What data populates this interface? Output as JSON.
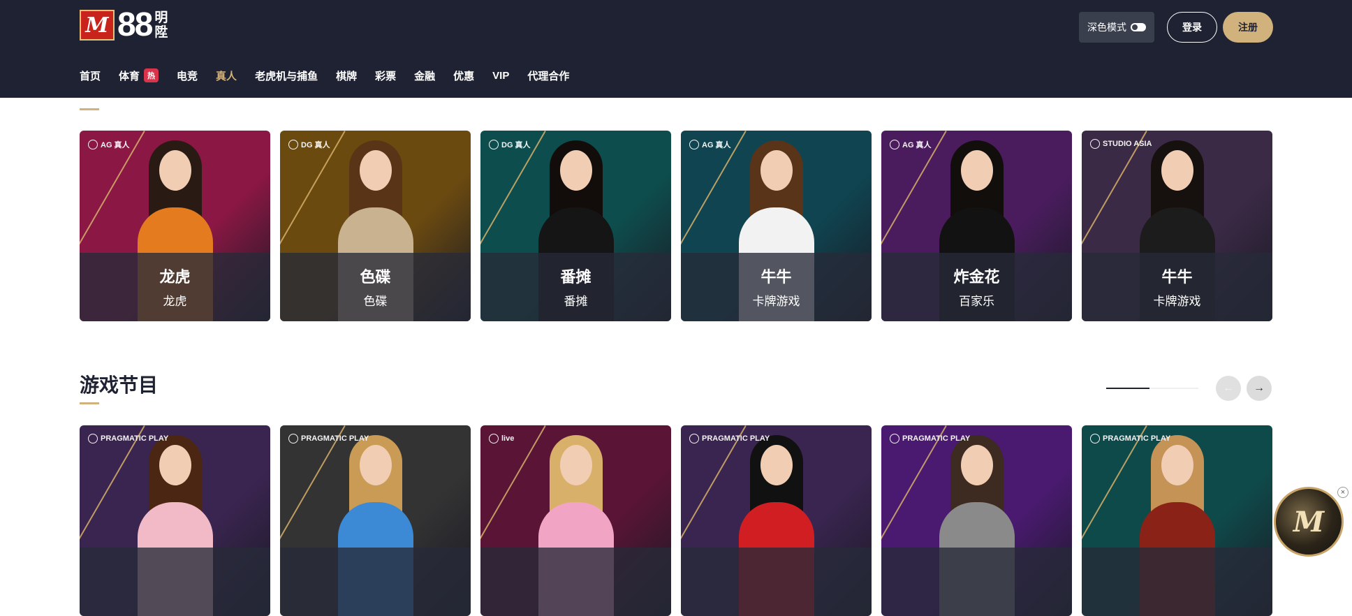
{
  "header": {
    "logo_mark": "M",
    "logo_num": "88",
    "logo_cn": [
      "明",
      "陞"
    ],
    "dark_mode_label": "深色模式",
    "login_label": "登录",
    "register_label": "注册"
  },
  "nav": [
    {
      "label": "首页"
    },
    {
      "label": "体育",
      "badge": "热"
    },
    {
      "label": "电竞"
    },
    {
      "label": "真人",
      "active": true
    },
    {
      "label": "老虎机与捕鱼"
    },
    {
      "label": "棋牌"
    },
    {
      "label": "彩票"
    },
    {
      "label": "金融"
    },
    {
      "label": "优惠"
    },
    {
      "label": "VIP"
    },
    {
      "label": "代理合作"
    }
  ],
  "live_cards": [
    {
      "provider": "AG 真人",
      "title": "龙虎",
      "subtitle": "龙虎",
      "bg": "#8a1744",
      "hair": "#2a1a14",
      "body": "#e47b1f"
    },
    {
      "provider": "DG 真人",
      "title": "色碟",
      "subtitle": "色碟",
      "bg": "#6b4a10",
      "hair": "#5a3417",
      "body": "#c9b28f"
    },
    {
      "provider": "DG 真人",
      "title": "番摊",
      "subtitle": "番摊",
      "bg": "#0e4d4d",
      "hair": "#120c0a",
      "body": "#151515"
    },
    {
      "provider": "AG 真人",
      "title": "牛牛",
      "subtitle": "卡牌游戏",
      "bg": "#0f4450",
      "hair": "#5a3418",
      "body": "#f2f2f2"
    },
    {
      "provider": "AG 真人",
      "title": "炸金花",
      "subtitle": "百家乐",
      "bg": "#4a1c5e",
      "hair": "#120e0c",
      "body": "#121212"
    },
    {
      "provider": "STUDIO ASIA",
      "title": "牛牛",
      "subtitle": "卡牌游戏",
      "bg": "#3b2a46",
      "hair": "#16100e",
      "body": "#1c1c1c"
    }
  ],
  "game_show_section": {
    "title": "游戏节目",
    "prev_label": "←",
    "next_label": "→"
  },
  "show_cards": [
    {
      "provider": "PRAGMATIC PLAY",
      "bg": "#3a2550",
      "hair": "#4a2613",
      "body": "#f2b9c7"
    },
    {
      "provider": "PRAGMATIC PLAY",
      "bg": "#333333",
      "hair": "#c99b55",
      "body": "#3c8ad6"
    },
    {
      "provider": "live",
      "bg": "#5a1436",
      "hair": "#d8b06a",
      "body": "#f1a4c4"
    },
    {
      "provider": "PRAGMATIC PLAY",
      "bg": "#3a2550",
      "hair": "#111111",
      "body": "#d11e22"
    },
    {
      "provider": "PRAGMATIC PLAY",
      "bg": "#4a1a70",
      "hair": "#3d2a20",
      "body": "#8a8a8a"
    },
    {
      "provider": "PRAGMATIC PLAY",
      "bg": "#0f4a4a",
      "hair": "#c49355",
      "body": "#8a2218"
    }
  ],
  "floating_badge": {
    "mark": "M",
    "close": "×"
  }
}
